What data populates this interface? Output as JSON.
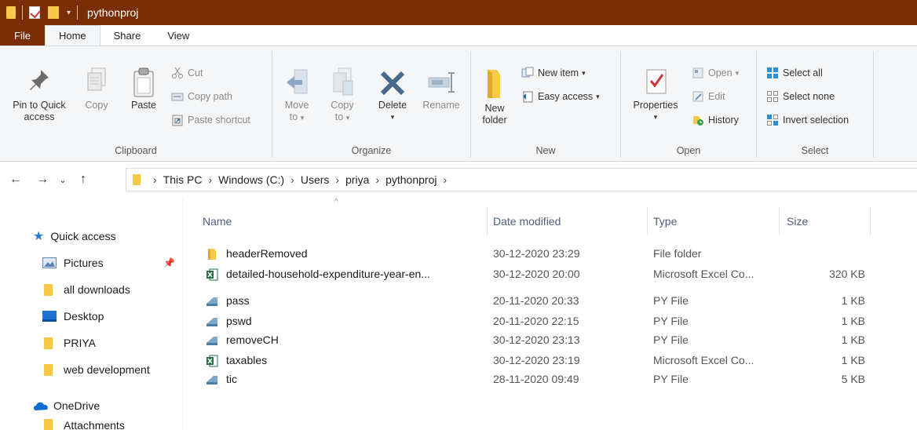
{
  "window": {
    "title": "pythonproj",
    "accent": "#7a2e06"
  },
  "tabs": [
    {
      "label": "File"
    },
    {
      "label": "Home"
    },
    {
      "label": "Share"
    },
    {
      "label": "View"
    }
  ],
  "ribbon": {
    "clipboard": {
      "label": "Clipboard",
      "pin_line1": "Pin to Quick",
      "pin_line2": "access",
      "copy": "Copy",
      "paste": "Paste",
      "cut": "Cut",
      "copy_path": "Copy path",
      "paste_shortcut": "Paste shortcut"
    },
    "organize": {
      "label": "Organize",
      "move_line1": "Move",
      "move_line2": "to",
      "copy_line1": "Copy",
      "copy_line2": "to",
      "delete": "Delete",
      "rename": "Rename"
    },
    "new": {
      "label": "New",
      "new_folder_line1": "New",
      "new_folder_line2": "folder",
      "new_item": "New item",
      "easy_access": "Easy access"
    },
    "open": {
      "label": "Open",
      "properties": "Properties",
      "open": "Open",
      "edit": "Edit",
      "history": "History"
    },
    "select": {
      "label": "Select",
      "select_all": "Select all",
      "select_none": "Select none",
      "invert_selection": "Invert selection"
    }
  },
  "address": {
    "crumbs": [
      "This PC",
      "Windows (C:)",
      "Users",
      "priya",
      "pythonproj"
    ]
  },
  "nav_pane": {
    "quick_access": "Quick access",
    "items": [
      "Pictures",
      "all downloads",
      "Desktop",
      "PRIYA",
      "web development"
    ],
    "onedrive": "OneDrive",
    "partial": "Attachments"
  },
  "columns": {
    "name": "Name",
    "date": "Date modified",
    "type": "Type",
    "size": "Size"
  },
  "files": [
    {
      "name": "headerRemoved",
      "date": "30-12-2020 23:29",
      "type": "File folder",
      "size": "",
      "icon": "folder-icon"
    },
    {
      "name": "detailed-household-expenditure-year-en...",
      "date": "30-12-2020 20:00",
      "type": "Microsoft Excel Co...",
      "size": "320 KB",
      "icon": "excel-icon"
    },
    {
      "name": "pass",
      "date": "20-11-2020 20:33",
      "type": "PY File",
      "size": "1 KB",
      "icon": "py-file-icon"
    },
    {
      "name": "pswd",
      "date": "20-11-2020 22:15",
      "type": "PY File",
      "size": "1 KB",
      "icon": "py-file-icon"
    },
    {
      "name": "removeCH",
      "date": "30-12-2020 23:13",
      "type": "PY File",
      "size": "1 KB",
      "icon": "py-file-icon"
    },
    {
      "name": "taxables",
      "date": "30-12-2020 23:19",
      "type": "Microsoft Excel Co...",
      "size": "1 KB",
      "icon": "excel-icon"
    },
    {
      "name": "tic",
      "date": "28-11-2020 09:49",
      "type": "PY File",
      "size": "5 KB",
      "icon": "py-file-icon"
    }
  ]
}
